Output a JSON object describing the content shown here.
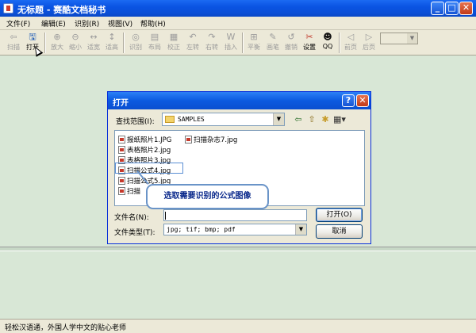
{
  "window": {
    "title": "无标题 - 赛酷文档秘书",
    "minimize_label": "_",
    "maximize_label": "□",
    "close_label": "✕"
  },
  "menu": [
    "文件(F)",
    "编辑(E)",
    "识别(R)",
    "视图(V)",
    "帮助(H)"
  ],
  "toolbar": {
    "buttons": [
      {
        "label": "扫描",
        "icon": "scanner-icon",
        "glyph": "⇦"
      },
      {
        "label": "打开",
        "icon": "open-folder-icon",
        "glyph": "🖫"
      },
      {
        "label": "放大",
        "icon": "zoom-in-icon",
        "glyph": "⊕"
      },
      {
        "label": "缩小",
        "icon": "zoom-out-icon",
        "glyph": "⊖"
      },
      {
        "label": "适宽",
        "icon": "fit-width-icon",
        "glyph": "↔"
      },
      {
        "label": "适高",
        "icon": "fit-height-icon",
        "glyph": "↕"
      },
      {
        "label": "识别",
        "icon": "recognize-icon",
        "glyph": "◎"
      },
      {
        "label": "布局",
        "icon": "layout-icon",
        "glyph": "▤"
      },
      {
        "label": "校正",
        "icon": "correct-icon",
        "glyph": "▦"
      },
      {
        "label": "左转",
        "icon": "rotate-left-icon",
        "glyph": "↶"
      },
      {
        "label": "右转",
        "icon": "rotate-right-icon",
        "glyph": "↷"
      },
      {
        "label": "插入",
        "icon": "insert-icon",
        "glyph": "W"
      },
      {
        "label": "平衡",
        "icon": "balance-icon",
        "glyph": "⊞"
      },
      {
        "label": "画笔",
        "icon": "pen-icon",
        "glyph": "✎"
      },
      {
        "label": "撤销",
        "icon": "undo-icon",
        "glyph": "↺"
      },
      {
        "label": "设置",
        "icon": "settings-icon",
        "glyph": "✂"
      },
      {
        "label": "QQ",
        "icon": "qq-icon",
        "glyph": "☻"
      },
      {
        "label": "前页",
        "icon": "prev-page-icon",
        "glyph": "◁"
      },
      {
        "label": "后页",
        "icon": "next-page-icon",
        "glyph": "▷"
      }
    ],
    "zoom_combo_value": ""
  },
  "dialog": {
    "title": "打开",
    "help_label": "?",
    "close_label": "✕",
    "lookin_label": "查找范围(I):",
    "lookin_value": "SAMPLES",
    "files": [
      {
        "name": "报纸照片1.JPG"
      },
      {
        "name": "表格照片2.jpg"
      },
      {
        "name": "表格照片3.jpg"
      },
      {
        "name": "扫描公式4.jpg"
      },
      {
        "name": "扫描公式5.jpg"
      },
      {
        "name": "扫描"
      },
      {
        "name": "扫描杂志7.jpg"
      }
    ],
    "callout": "选取需要识别的公式图像",
    "filename_label": "文件名(N):",
    "filename_value": "",
    "filetype_label": "文件类型(T):",
    "filetype_value": "jpg; tif; bmp; pdf",
    "open_button": "打开(O)",
    "cancel_button": "取消"
  },
  "status": {
    "text": "轻松汉语通，外国人学中文的贴心老师"
  }
}
